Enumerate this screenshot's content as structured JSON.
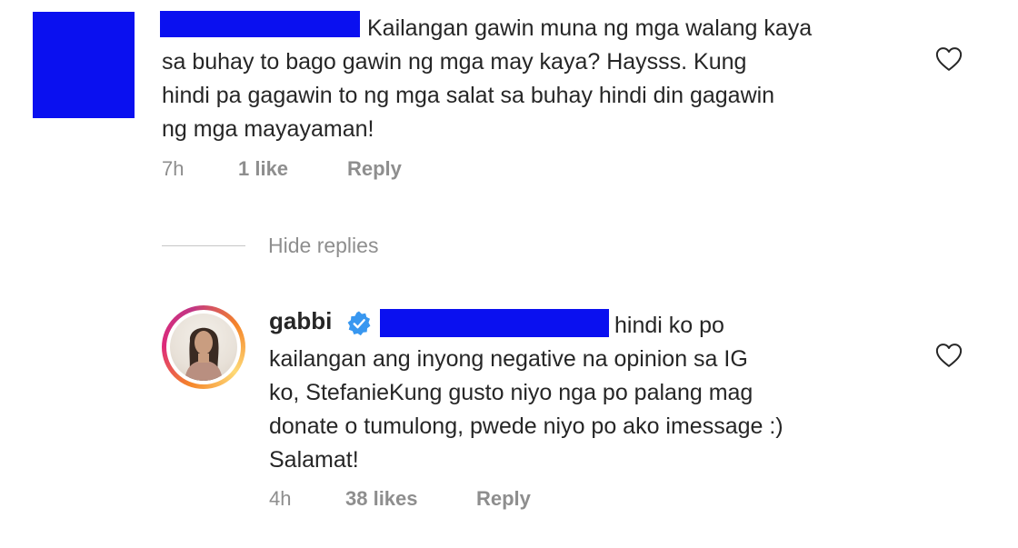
{
  "comments": [
    {
      "avatar": "redacted",
      "name_redacted": true,
      "lines": [
        "Kailangan gawin muna ng mga walang kaya",
        "sa buhay to bago gawin ng mga may kaya? Haysss. Kung",
        "hindi pa gagawin to ng mga salat sa buhay hindi din gagawin",
        "ng mga mayayaman!"
      ],
      "time": "7h",
      "likes": "1 like",
      "reply_label": "Reply",
      "heart_icon": "heart-outline-icon"
    }
  ],
  "hide_replies_label": "Hide replies",
  "reply": {
    "username": "gabbi",
    "verified_icon": "verified-badge-icon",
    "name_redacted": true,
    "lines": [
      "hindi ko po",
      "kailangan ang inyong negative na opinion sa IG",
      "ko, StefanieKung gusto niyo nga po palang mag",
      "donate o tumulong, pwede niyo po ako imessage :)",
      "Salamat!"
    ],
    "time": "4h",
    "likes": "38 likes",
    "reply_label": "Reply",
    "heart_icon": "heart-outline-icon"
  },
  "colors": {
    "redaction": "#0a10f0",
    "verified": "#3897f0",
    "text": "#262626",
    "meta": "#8e8e8e"
  }
}
